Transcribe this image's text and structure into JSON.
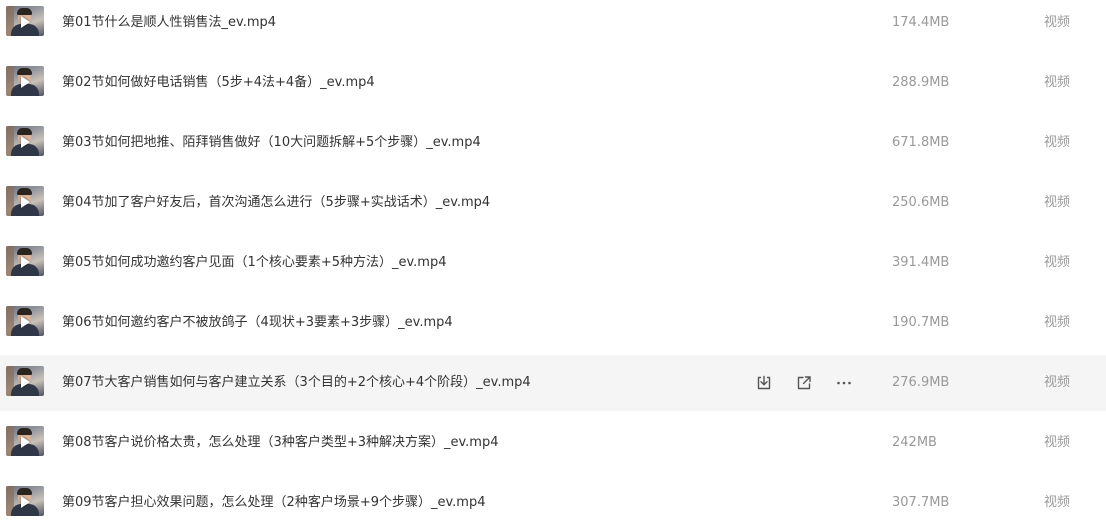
{
  "files": [
    {
      "name": "第01节什么是顺人性销售法_ev.mp4",
      "size": "174.4MB",
      "type": "视频"
    },
    {
      "name": "第02节如何做好电话销售（5步+4法+4备）_ev.mp4",
      "size": "288.9MB",
      "type": "视频"
    },
    {
      "name": "第03节如何把地推、陌拜销售做好（10大问题拆解+5个步骤）_ev.mp4",
      "size": "671.8MB",
      "type": "视频"
    },
    {
      "name": "第04节加了客户好友后，首次沟通怎么进行（5步骤+实战话术）_ev.mp4",
      "size": "250.6MB",
      "type": "视频"
    },
    {
      "name": "第05节如何成功邀约客户见面（1个核心要素+5种方法）_ev.mp4",
      "size": "391.4MB",
      "type": "视频"
    },
    {
      "name": "第06节如何邀约客户不被放鸽子（4现状+3要素+3步骤）_ev.mp4",
      "size": "190.7MB",
      "type": "视频"
    },
    {
      "name": "第07节大客户销售如何与客户建立关系（3个目的+2个核心+4个阶段）_ev.mp4",
      "size": "276.9MB",
      "type": "视频"
    },
    {
      "name": "第08节客户说价格太贵，怎么处理（3种客户类型+3种解决方案）_ev.mp4",
      "size": "242MB",
      "type": "视频"
    },
    {
      "name": "第09节客户担心效果问题，怎么处理（2种客户场景+9个步骤）_ev.mp4",
      "size": "307.7MB",
      "type": "视频"
    }
  ],
  "hovered_row": 6,
  "row_actions": [
    "download-icon",
    "share-icon",
    "more-icon"
  ],
  "colors": {
    "hover_bg": "#f5f5f6",
    "name_text": "#333333",
    "meta_text": "#999999"
  }
}
